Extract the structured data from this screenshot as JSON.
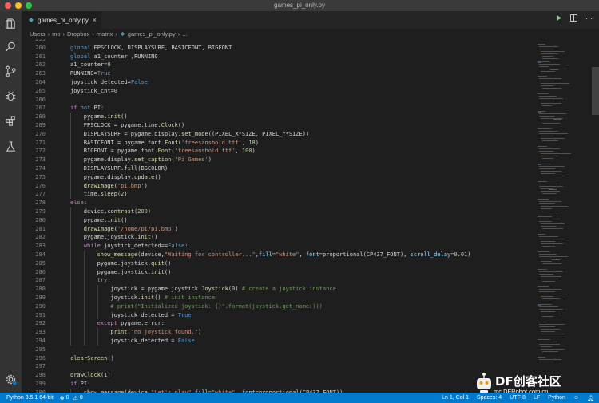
{
  "window": {
    "title": "games_pi_only.py"
  },
  "tab": {
    "label": "games_pi_only.py",
    "close": "×"
  },
  "breadcrumb": [
    "Users",
    "mo",
    "Dropbox",
    "matrix",
    "games_pi_only.py",
    "..."
  ],
  "code_lines": [
    {
      "n": "259",
      "indent": 0,
      "spans": []
    },
    {
      "n": "260",
      "indent": 0,
      "spans": [
        [
          "kw",
          "global"
        ],
        [
          "op",
          " FPSCLOCK, DISPLAYSURF, BASICFONT, BIGFONT"
        ]
      ]
    },
    {
      "n": "261",
      "indent": 0,
      "spans": [
        [
          "kw",
          "global"
        ],
        [
          "op",
          " a1_counter ,RUNNING"
        ]
      ]
    },
    {
      "n": "262",
      "indent": 0,
      "spans": [
        [
          "op",
          "a1_counter="
        ],
        [
          "nm",
          "0"
        ]
      ]
    },
    {
      "n": "263",
      "indent": 0,
      "spans": [
        [
          "op",
          "RUNNING="
        ],
        [
          "kw",
          "True"
        ]
      ]
    },
    {
      "n": "264",
      "indent": 0,
      "spans": [
        [
          "op",
          "joystick_detected="
        ],
        [
          "kw",
          "False"
        ]
      ]
    },
    {
      "n": "265",
      "indent": 0,
      "spans": [
        [
          "op",
          "joystick_cnt="
        ],
        [
          "nm",
          "0"
        ]
      ]
    },
    {
      "n": "266",
      "indent": 0,
      "spans": []
    },
    {
      "n": "267",
      "indent": 0,
      "spans": [
        [
          "kwc",
          "if"
        ],
        [
          "op",
          " "
        ],
        [
          "kw",
          "not"
        ],
        [
          "op",
          " PI:"
        ]
      ]
    },
    {
      "n": "268",
      "indent": 1,
      "spans": [
        [
          "op",
          "pygame."
        ],
        [
          "fn",
          "init"
        ],
        [
          "op",
          "()"
        ]
      ]
    },
    {
      "n": "269",
      "indent": 1,
      "spans": [
        [
          "op",
          "FPSCLOCK = pygame.time."
        ],
        [
          "fn",
          "Clock"
        ],
        [
          "op",
          "()"
        ]
      ]
    },
    {
      "n": "270",
      "indent": 1,
      "spans": [
        [
          "op",
          "DISPLAYSURF = pygame.display."
        ],
        [
          "fn",
          "set_mode"
        ],
        [
          "op",
          "((PIXEL_X*SIZE, PIXEL_Y*SIZE))"
        ]
      ]
    },
    {
      "n": "271",
      "indent": 1,
      "spans": [
        [
          "op",
          "BASICFONT = pygame.font."
        ],
        [
          "fn",
          "Font"
        ],
        [
          "op",
          "("
        ],
        [
          "st",
          "'freesansbold.ttf'"
        ],
        [
          "op",
          ", "
        ],
        [
          "nm",
          "18"
        ],
        [
          "op",
          ")"
        ]
      ]
    },
    {
      "n": "272",
      "indent": 1,
      "spans": [
        [
          "op",
          "BIGFONT = pygame.font."
        ],
        [
          "fn",
          "Font"
        ],
        [
          "op",
          "("
        ],
        [
          "st",
          "'freesansbold.ttf'"
        ],
        [
          "op",
          ", "
        ],
        [
          "nm",
          "100"
        ],
        [
          "op",
          ")"
        ]
      ]
    },
    {
      "n": "273",
      "indent": 1,
      "spans": [
        [
          "op",
          "pygame.display."
        ],
        [
          "fn",
          "set_caption"
        ],
        [
          "op",
          "("
        ],
        [
          "st",
          "'Pi Games'"
        ],
        [
          "op",
          ")"
        ]
      ]
    },
    {
      "n": "274",
      "indent": 1,
      "spans": [
        [
          "op",
          "DISPLAYSURF."
        ],
        [
          "fn",
          "fill"
        ],
        [
          "op",
          "(BGCOLOR)"
        ]
      ]
    },
    {
      "n": "275",
      "indent": 1,
      "spans": [
        [
          "op",
          "pygame.display."
        ],
        [
          "fn",
          "update"
        ],
        [
          "op",
          "()"
        ]
      ]
    },
    {
      "n": "276",
      "indent": 1,
      "spans": [
        [
          "fn",
          "drawImage"
        ],
        [
          "op",
          "("
        ],
        [
          "st",
          "'pi.bmp'"
        ],
        [
          "op",
          ")"
        ]
      ]
    },
    {
      "n": "277",
      "indent": 1,
      "spans": [
        [
          "op",
          "time."
        ],
        [
          "fn",
          "sleep"
        ],
        [
          "op",
          "("
        ],
        [
          "nm",
          "2"
        ],
        [
          "op",
          ")"
        ]
      ]
    },
    {
      "n": "278",
      "indent": 0,
      "spans": [
        [
          "kwc",
          "else"
        ],
        [
          "op",
          ":"
        ]
      ]
    },
    {
      "n": "279",
      "indent": 1,
      "spans": [
        [
          "op",
          "device."
        ],
        [
          "fn",
          "contrast"
        ],
        [
          "op",
          "("
        ],
        [
          "nm",
          "200"
        ],
        [
          "op",
          ")"
        ]
      ]
    },
    {
      "n": "280",
      "indent": 1,
      "spans": [
        [
          "op",
          "pygame."
        ],
        [
          "fn",
          "init"
        ],
        [
          "op",
          "()"
        ]
      ]
    },
    {
      "n": "281",
      "indent": 1,
      "spans": [
        [
          "fn",
          "drawImage"
        ],
        [
          "op",
          "("
        ],
        [
          "st",
          "'/home/pi/pi.bmp'"
        ],
        [
          "op",
          ")"
        ]
      ]
    },
    {
      "n": "282",
      "indent": 1,
      "spans": [
        [
          "op",
          "pygame.joystick."
        ],
        [
          "fn",
          "init"
        ],
        [
          "op",
          "()"
        ]
      ]
    },
    {
      "n": "283",
      "indent": 1,
      "spans": [
        [
          "kwc",
          "while"
        ],
        [
          "op",
          " joystick_detected=="
        ],
        [
          "kw",
          "False"
        ],
        [
          "op",
          ":"
        ]
      ]
    },
    {
      "n": "284",
      "indent": 2,
      "spans": [
        [
          "fn",
          "show_message"
        ],
        [
          "op",
          "(device,"
        ],
        [
          "st",
          "\"Waiting for controller...\""
        ],
        [
          "op",
          ","
        ],
        [
          "var",
          "fill"
        ],
        [
          "op",
          "="
        ],
        [
          "st",
          "\"white\""
        ],
        [
          "op",
          ", "
        ],
        [
          "var",
          "font"
        ],
        [
          "op",
          "=proportional(CP437_FONT), "
        ],
        [
          "var",
          "scroll_delay"
        ],
        [
          "op",
          "="
        ],
        [
          "nm",
          "0.01"
        ],
        [
          "op",
          ")"
        ]
      ]
    },
    {
      "n": "285",
      "indent": 2,
      "spans": [
        [
          "op",
          "pygame.joystick."
        ],
        [
          "fn",
          "quit"
        ],
        [
          "op",
          "()"
        ]
      ]
    },
    {
      "n": "286",
      "indent": 2,
      "spans": [
        [
          "op",
          "pygame.joystick."
        ],
        [
          "fn",
          "init"
        ],
        [
          "op",
          "()"
        ]
      ]
    },
    {
      "n": "287",
      "indent": 2,
      "spans": [
        [
          "kwc",
          "try"
        ],
        [
          "op",
          ":"
        ]
      ]
    },
    {
      "n": "288",
      "indent": 3,
      "spans": [
        [
          "op",
          "joystick = pygame.joystick."
        ],
        [
          "fn",
          "Joystick"
        ],
        [
          "op",
          "("
        ],
        [
          "nm",
          "0"
        ],
        [
          "op",
          ") "
        ],
        [
          "cm",
          "# create a joystick instance"
        ]
      ]
    },
    {
      "n": "289",
      "indent": 3,
      "spans": [
        [
          "op",
          "joystick."
        ],
        [
          "fn",
          "init"
        ],
        [
          "op",
          "() "
        ],
        [
          "cm",
          "# init instance"
        ]
      ]
    },
    {
      "n": "290",
      "indent": 3,
      "spans": [
        [
          "cm",
          "# print(\"Initialized joystick: {}\".format(joystick.get_name()))"
        ]
      ]
    },
    {
      "n": "291",
      "indent": 3,
      "spans": [
        [
          "op",
          "joystick_detected = "
        ],
        [
          "kw",
          "True"
        ]
      ]
    },
    {
      "n": "292",
      "indent": 2,
      "spans": [
        [
          "kwc",
          "except"
        ],
        [
          "op",
          " pygame.error:"
        ]
      ]
    },
    {
      "n": "293",
      "indent": 3,
      "spans": [
        [
          "fn",
          "print"
        ],
        [
          "op",
          "("
        ],
        [
          "st",
          "\"no joystick found.\""
        ],
        [
          "op",
          ")"
        ]
      ]
    },
    {
      "n": "294",
      "indent": 3,
      "spans": [
        [
          "op",
          "joystick_detected = "
        ],
        [
          "kw",
          "False"
        ]
      ]
    },
    {
      "n": "295",
      "indent": 0,
      "spans": []
    },
    {
      "n": "296",
      "indent": 0,
      "spans": [
        [
          "fn",
          "clearScreen"
        ],
        [
          "op",
          "()"
        ]
      ]
    },
    {
      "n": "297",
      "indent": 0,
      "spans": []
    },
    {
      "n": "298",
      "indent": 0,
      "spans": [
        [
          "fn",
          "drawClock"
        ],
        [
          "op",
          "("
        ],
        [
          "nm",
          "1"
        ],
        [
          "op",
          ")"
        ]
      ]
    },
    {
      "n": "299",
      "indent": 0,
      "spans": [
        [
          "kwc",
          "if"
        ],
        [
          "op",
          " PI:"
        ]
      ]
    },
    {
      "n": "300",
      "indent": 1,
      "spans": [
        [
          "fn",
          "show_message"
        ],
        [
          "op",
          "(device,"
        ],
        [
          "st",
          "\"Let's play\""
        ],
        [
          "op",
          ","
        ],
        [
          "var",
          "fill"
        ],
        [
          "op",
          "="
        ],
        [
          "st",
          "\"white\""
        ],
        [
          "op",
          ", "
        ],
        [
          "var",
          "font"
        ],
        [
          "op",
          "=proportional(CP437_FONT))"
        ]
      ]
    }
  ],
  "status": {
    "python": "Python 3.5.1 64-bit",
    "errors": "0",
    "warnings": "0",
    "position": "Ln 1, Col 1",
    "spaces": "Spaces: 4",
    "encoding": "UTF-8",
    "eol": "LF",
    "language": "Python"
  },
  "watermark": {
    "brand": "DF创客社区",
    "url": "mc.DFRobot.com.cn"
  },
  "colors": {
    "statusbar": "#007acc",
    "editor_bg": "#1e1e1e",
    "keyword": "#569cd6",
    "string": "#ce9178",
    "comment": "#6a9955"
  }
}
